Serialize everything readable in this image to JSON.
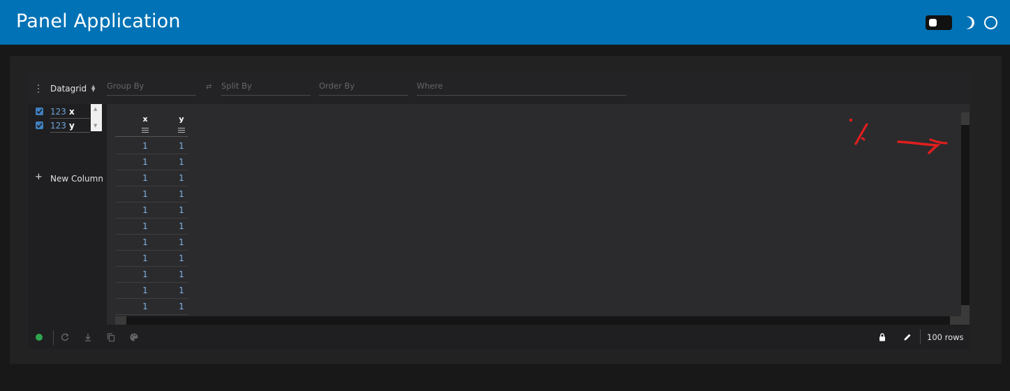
{
  "app": {
    "title": "Panel Application"
  },
  "header": {
    "theme_toggle_icon": "toggle-switch",
    "moon_icon": "moon-icon",
    "circle_icon": "circle-icon",
    "background": "#0072b5"
  },
  "toolbar": {
    "plugin": "Datagrid",
    "group_by_placeholder": "Group By",
    "split_by_placeholder": "Split By",
    "order_by_placeholder": "Order By",
    "where_placeholder": "Where"
  },
  "columns": [
    {
      "type": "123",
      "name": "x",
      "checked": true
    },
    {
      "type": "123",
      "name": "y",
      "checked": true
    }
  ],
  "new_column_label": "New Column",
  "grid": {
    "headers": [
      "x",
      "y"
    ],
    "rows": [
      [
        "1",
        "1"
      ],
      [
        "1",
        "1"
      ],
      [
        "1",
        "1"
      ],
      [
        "1",
        "1"
      ],
      [
        "1",
        "1"
      ],
      [
        "1",
        "1"
      ],
      [
        "1",
        "1"
      ],
      [
        "1",
        "1"
      ],
      [
        "1",
        "1"
      ],
      [
        "1",
        "1"
      ],
      [
        "1",
        "1"
      ]
    ]
  },
  "status": {
    "connected_color": "#2ea44f",
    "rows_label": "100 rows"
  }
}
